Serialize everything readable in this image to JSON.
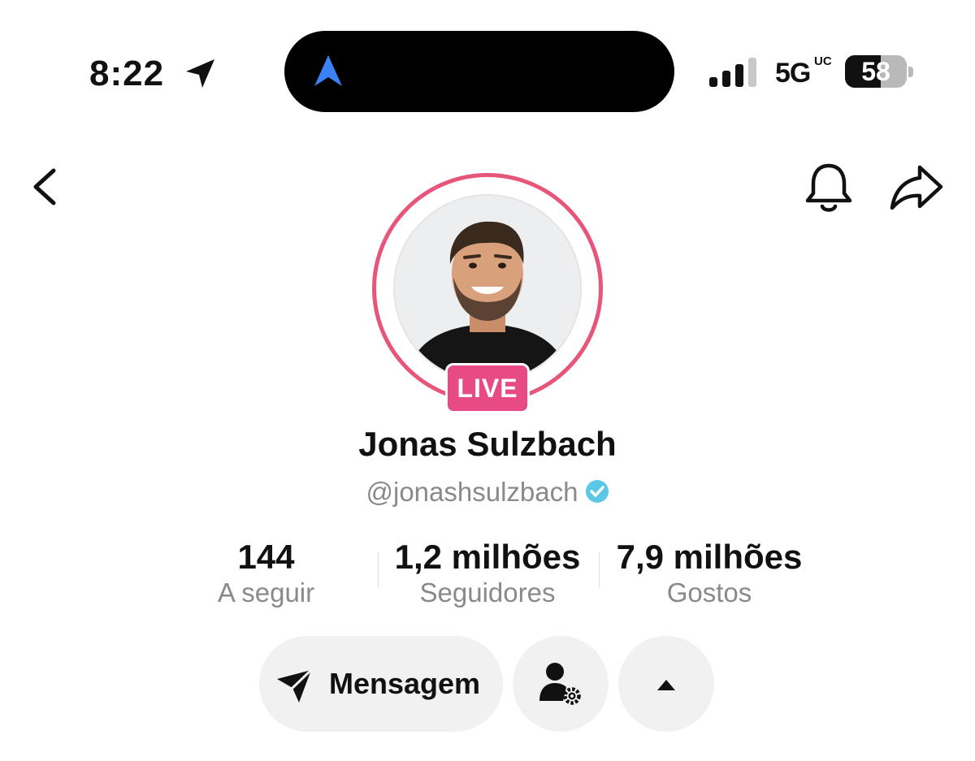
{
  "status_bar": {
    "time": "8:22",
    "network": "5G",
    "network_suffix": "UC",
    "battery_percent": "58",
    "battery_level": 0.58,
    "signal_bars_active": 3,
    "signal_bars_total": 4
  },
  "top_nav": {
    "back_icon": "chevron-left-icon",
    "notifications_icon": "bell-icon",
    "share_icon": "share-arrow-icon"
  },
  "profile": {
    "display_name": "Jonas Sulzbach",
    "handle": "@jonashsulzbach",
    "verified": true,
    "live_badge": "LIVE"
  },
  "stats": [
    {
      "value": "144",
      "label": "A seguir"
    },
    {
      "value": "1,2 milhões",
      "label": "Seguidores"
    },
    {
      "value": "7,9 milhões",
      "label": "Gostos"
    }
  ],
  "actions": {
    "message_label": "Mensagem",
    "message_icon": "send-icon",
    "follow_settings_icon": "user-gear-icon",
    "expand_icon": "caret-up-icon"
  },
  "colors": {
    "live_ring": "#e8557b",
    "live_badge": "#e84a84",
    "verified_badge": "#5cc8e8",
    "nav_arrow": "#3b82f6",
    "button_bg": "#f1f1f1",
    "secondary_text": "#8a8a8a"
  }
}
